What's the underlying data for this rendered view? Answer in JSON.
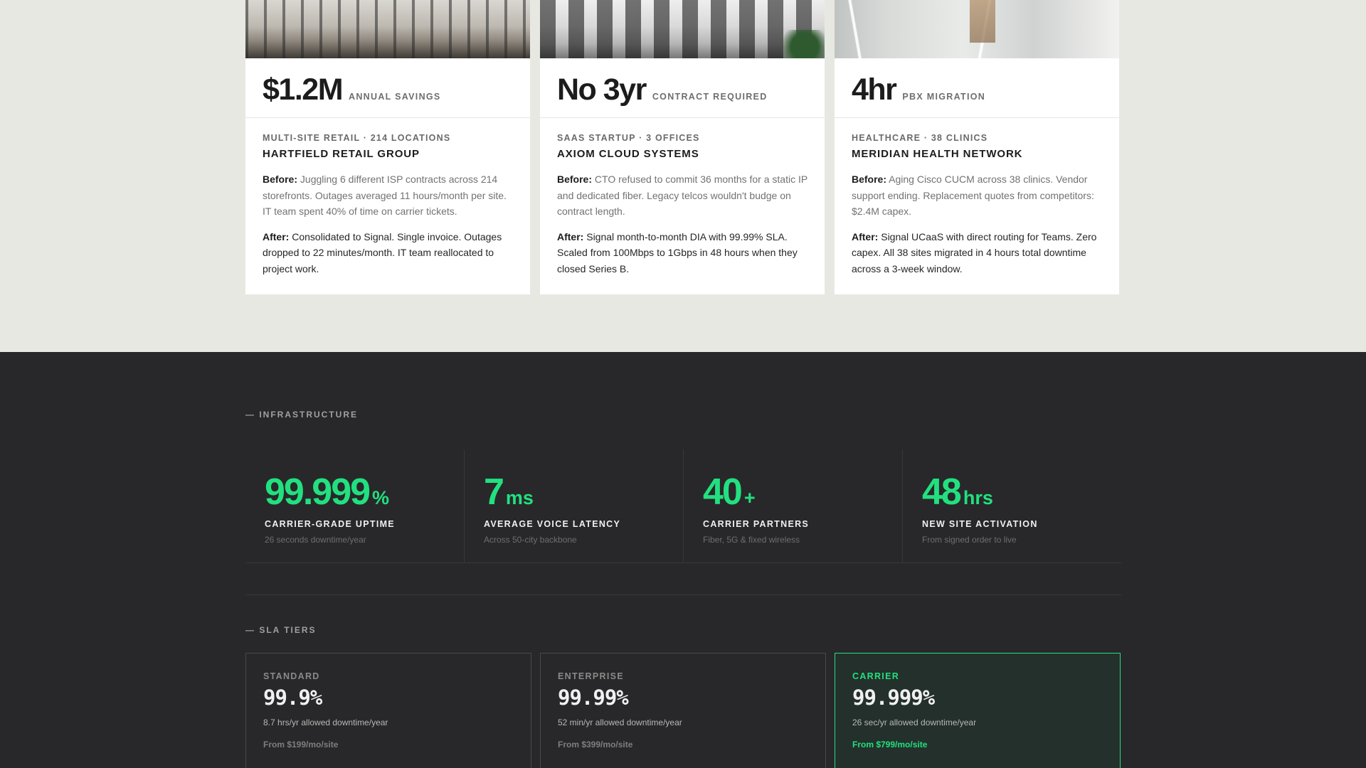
{
  "case_studies": [
    {
      "stat": "$1.2M",
      "stat_caption": "ANNUAL SAVINGS",
      "meta": "MULTI-SITE RETAIL · 214 LOCATIONS",
      "company": "HARTFIELD RETAIL GROUP",
      "before_label": "Before:",
      "before_text": "Juggling 6 different ISP contracts across 214 storefronts. Outages averaged 11 hours/month per site. IT team spent 40% of time on carrier tickets.",
      "after_label": "After:",
      "after_text": "Consolidated to Signal. Single invoice. Outages dropped to 22 minutes/month. IT team reallocated to project work."
    },
    {
      "stat": "No 3yr",
      "stat_caption": "CONTRACT REQUIRED",
      "meta": "SAAS STARTUP · 3 OFFICES",
      "company": "AXIOM CLOUD SYSTEMS",
      "before_label": "Before:",
      "before_text": "CTO refused to commit 36 months for a static IP and dedicated fiber. Legacy telcos wouldn't budge on contract length.",
      "after_label": "After:",
      "after_text": "Signal month-to-month DIA with 99.99% SLA. Scaled from 100Mbps to 1Gbps in 48 hours when they closed Series B."
    },
    {
      "stat": "4hr",
      "stat_caption": "PBX MIGRATION",
      "meta": "HEALTHCARE · 38 CLINICS",
      "company": "MERIDIAN HEALTH NETWORK",
      "before_label": "Before:",
      "before_text": "Aging Cisco CUCM across 38 clinics. Vendor support ending. Replacement quotes from competitors: $2.4M capex.",
      "after_label": "After:",
      "after_text": "Signal UCaaS with direct routing for Teams. Zero capex. All 38 sites migrated in 4 hours total downtime across a 3-week window."
    }
  ],
  "infrastructure": {
    "label": "— INFRASTRUCTURE",
    "metrics": [
      {
        "value": "99.999",
        "unit": "%",
        "title": "CARRIER-GRADE UPTIME",
        "sub": "26 seconds downtime/year"
      },
      {
        "value": "7",
        "unit": "ms",
        "title": "AVERAGE VOICE LATENCY",
        "sub": "Across 50-city backbone"
      },
      {
        "value": "40",
        "unit": "+",
        "title": "CARRIER PARTNERS",
        "sub": "Fiber, 5G & fixed wireless"
      },
      {
        "value": "48",
        "unit": "hrs",
        "title": "NEW SITE ACTIVATION",
        "sub": "From signed order to live"
      }
    ]
  },
  "sla": {
    "label": "— SLA TIERS",
    "tiers": [
      {
        "name": "STANDARD",
        "value": "99.9%",
        "allowance": "8.7 hrs/yr allowed downtime/year",
        "price": "From $199/mo/site"
      },
      {
        "name": "ENTERPRISE",
        "value": "99.99%",
        "allowance": "52 min/yr allowed downtime/year",
        "price": "From $399/mo/site"
      },
      {
        "name": "CARRIER",
        "value": "99.999%",
        "allowance": "26 sec/yr allowed downtime/year",
        "price": "From $799/mo/site"
      }
    ]
  },
  "colors": {
    "accent": "#22e07f",
    "dark_bg": "#28282a",
    "light_bg": "#e8e8e3"
  }
}
